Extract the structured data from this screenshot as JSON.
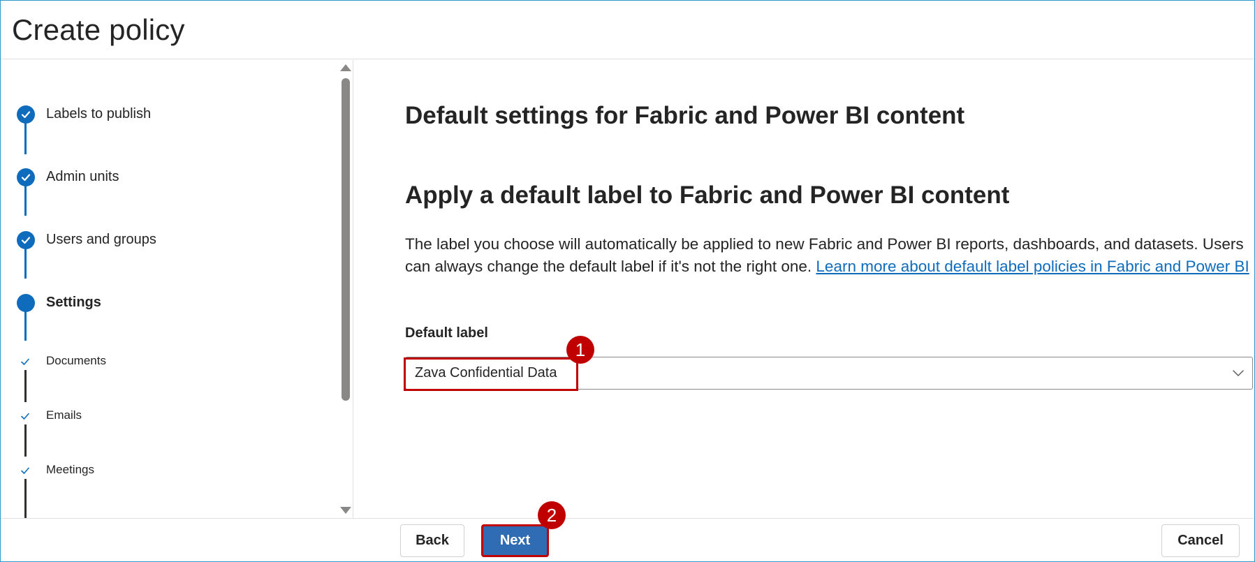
{
  "header": {
    "title": "Create policy"
  },
  "stepper": {
    "steps": [
      {
        "label": "Labels to publish",
        "state": "completed"
      },
      {
        "label": "Admin units",
        "state": "completed"
      },
      {
        "label": "Users and groups",
        "state": "completed"
      },
      {
        "label": "Settings",
        "state": "current"
      }
    ],
    "substeps": [
      {
        "label": "Documents",
        "state": "completed"
      },
      {
        "label": "Emails",
        "state": "completed"
      },
      {
        "label": "Meetings",
        "state": "completed"
      }
    ]
  },
  "main": {
    "section_heading": "Default settings for Fabric and Power BI content",
    "sub_heading": "Apply a default label to Fabric and Power BI content",
    "description": "The label you choose will automatically be applied to new Fabric and Power BI reports, dashboards, and datasets. Users can always change the default label if it's not the right one. ",
    "learn_more_link": "Learn more about default label policies in Fabric and Power BI",
    "field_label": "Default label",
    "dropdown_value": "Zava Confidential Data"
  },
  "footer": {
    "back_label": "Back",
    "next_label": "Next",
    "cancel_label": "Cancel"
  },
  "annotations": {
    "badge_1": "1",
    "badge_2": "2"
  },
  "colors": {
    "accent": "#0f6cbd",
    "annotation": "#c00000",
    "next_button": "#2f6cb3"
  }
}
